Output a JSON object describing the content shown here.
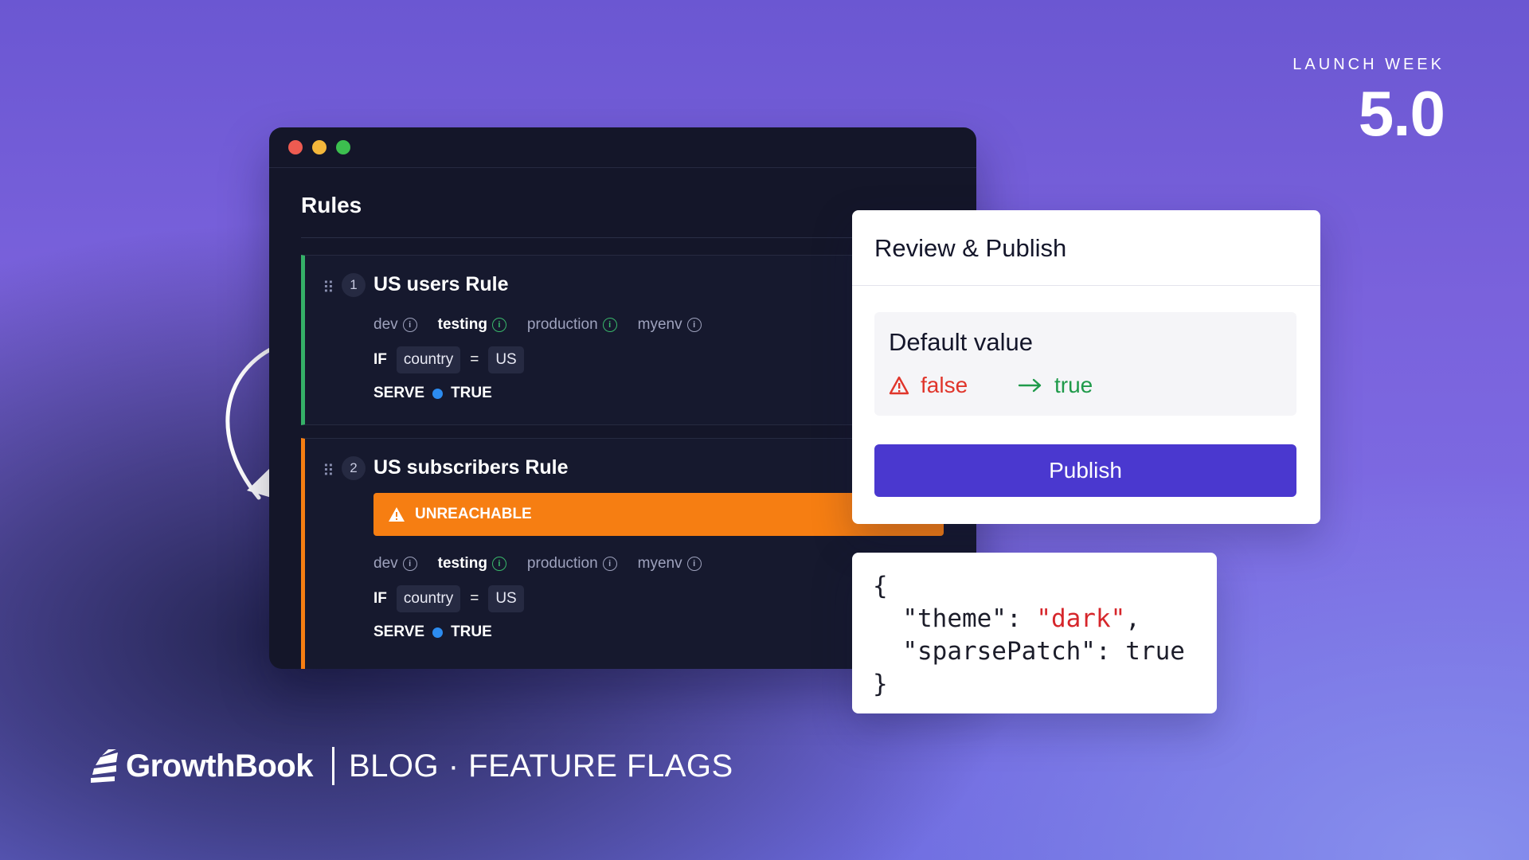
{
  "launch": {
    "label": "LAUNCH WEEK",
    "number": "5.0"
  },
  "rules_window": {
    "title": "Rules",
    "rules": [
      {
        "number": "1",
        "name": "US users Rule",
        "envs": [
          "dev",
          "testing",
          "production",
          "myenv"
        ],
        "condition": {
          "keyword": "IF",
          "attribute": "country",
          "operator": "=",
          "value": "US"
        },
        "serve": {
          "keyword": "SERVE",
          "value": "TRUE"
        },
        "accent": "#35b068"
      },
      {
        "number": "2",
        "name": "US subscribers Rule",
        "warning": "UNREACHABLE",
        "envs": [
          "dev",
          "testing",
          "production",
          "myenv"
        ],
        "condition": {
          "keyword": "IF",
          "attribute": "country",
          "operator": "=",
          "value": "US"
        },
        "serve": {
          "keyword": "SERVE",
          "value": "TRUE"
        },
        "accent": "#f67e12"
      }
    ]
  },
  "review_panel": {
    "title": "Review & Publish",
    "default_value_title": "Default value",
    "old_value": "false",
    "new_value": "true",
    "publish_label": "Publish"
  },
  "code": {
    "open": "{",
    "theme_key": "\"theme\"",
    "theme_value": "\"dark\"",
    "sparse_key": "\"sparsePatch\"",
    "sparse_value": "true",
    "close": "}"
  },
  "footer": {
    "brand": "GrowthBook",
    "section": "BLOG · FEATURE FLAGS"
  },
  "colors": {
    "accent_purple": "#4a38cf",
    "success_green": "#35b068",
    "warning_orange": "#f67e12",
    "error_red": "#e0352b"
  }
}
